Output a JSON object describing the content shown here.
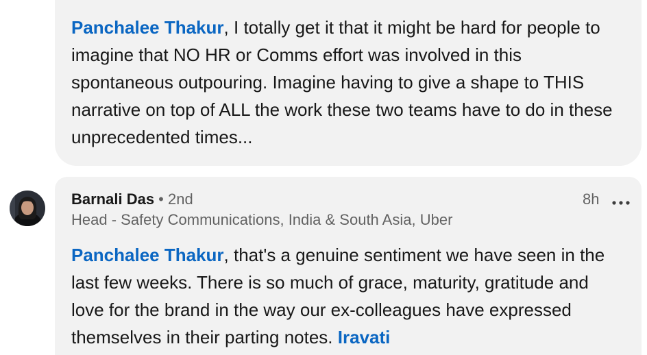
{
  "top_comment": {
    "mention": "Panchalee Thakur",
    "text": ", I totally get it that it might be hard for people to imagine that NO HR or Comms effort was involved in this spontaneous outpouring. Imagine having to give a shape to THIS narrative on top of ALL the work these two teams have to do in these unprecedented times..."
  },
  "bottom_comment": {
    "author": "Barnali Das",
    "separator": " • ",
    "degree": "2nd",
    "headline": "Head - Safety Communications, India & South Asia, Uber",
    "timestamp": "8h",
    "mention": "Panchalee Thakur",
    "text": ", that's a genuine sentiment we have seen in the last few weeks. There is so much of grace, maturity, gratitude and love for the brand in the way our ex-colleagues have expressed themselves in their parting notes. ",
    "mention_2": "Iravati"
  },
  "icons": {
    "avatar": "profile-photo",
    "more": "more-options-icon"
  },
  "colors": {
    "bubble": "#f2f2f2",
    "mention": "#0a66c2"
  }
}
